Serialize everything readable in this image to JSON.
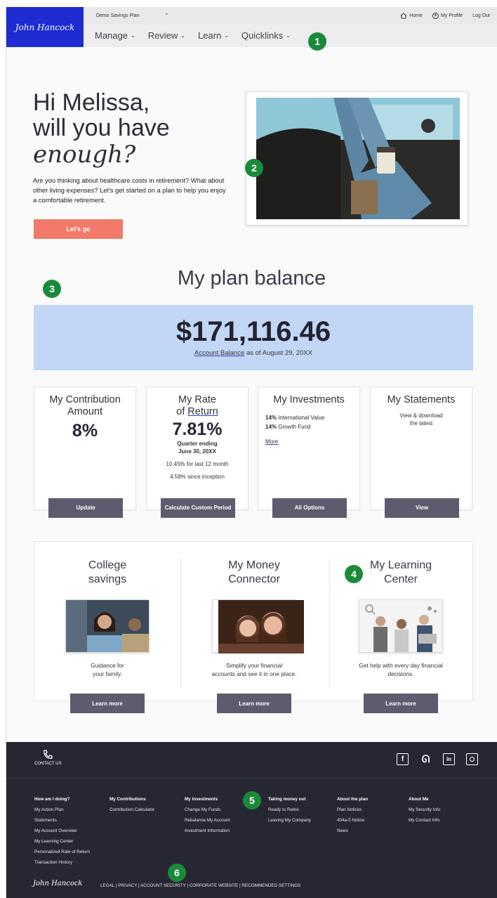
{
  "header": {
    "logo_text": "John Hancock",
    "plan_selector": "Demo Savings Plan",
    "top_links": {
      "home": "Home",
      "profile": "My Profile",
      "logout": "Log Out"
    },
    "nav": [
      "Manage",
      "Review",
      "Learn",
      "Quicklinks"
    ]
  },
  "badges": [
    "1",
    "2",
    "3",
    "4",
    "5",
    "6"
  ],
  "hero": {
    "line1": "Hi Melissa,",
    "line2": "will you have",
    "line3": "enough?",
    "description": "Are you thinking about healthcare costs in retirement? What about other living expenses? Let's get started on a plan to help you enjoy a comfortable retirement.",
    "cta": "Let's go"
  },
  "balance": {
    "title": "My plan balance",
    "amount": "$171,116.46",
    "label": "Account Balance",
    "as_of": "as of August 29, 20XX"
  },
  "cards": {
    "contribution": {
      "title1": "My Contribution",
      "title2": "Amount",
      "value": "8%",
      "button": "Update"
    },
    "return": {
      "title1": "My Rate",
      "title2a": "of ",
      "title2b": "Return",
      "value": "7.81%",
      "period1": "Quarter ending",
      "period2": "June 30, 20XX",
      "line1": "10.45% for last 12 month",
      "line2": "4.58% since inception",
      "button": "Calculate Custom Period"
    },
    "investments": {
      "title": "My Investments",
      "items": [
        {
          "pct": "14%",
          "name": "International Value"
        },
        {
          "pct": "14%",
          "name": "Growth Fund"
        }
      ],
      "more": "More",
      "button": "All Options"
    },
    "statements": {
      "title": "My Statements",
      "desc1": "View & download",
      "desc2": "the latest",
      "button": "View"
    }
  },
  "learn": [
    {
      "title1": "College",
      "title2": "savings",
      "desc1": "Guidance for",
      "desc2": "your family.",
      "button": "Learn more"
    },
    {
      "title1": "My Money",
      "title2": "Connector",
      "desc1": "Simplify your financial",
      "desc2": "accounts and see it in one place.",
      "button": "Learn more"
    },
    {
      "title1": "My Learning",
      "title2": "Center",
      "desc1": "Get help with every day financial",
      "desc2": "decisions.",
      "button": "Learn more"
    }
  ],
  "footer": {
    "contact": "CONTACT US",
    "social": [
      "f",
      "t",
      "in",
      "ig"
    ],
    "columns": [
      {
        "heading": "How am I doing?",
        "links": [
          "My Action Plan",
          "Statements",
          "My Account Overview",
          "My Learning Center",
          "Personalized Rate of Return",
          "Transaction History"
        ]
      },
      {
        "heading": "My Contributions",
        "links": [
          "Contribution Calculator"
        ]
      },
      {
        "heading": "My investments",
        "links": [
          "Change My Funds",
          "Rebalance My Account",
          "Investment Information"
        ]
      },
      {
        "heading": "Taking money out",
        "links": [
          "Ready to Retire",
          "Leaving My Company"
        ]
      },
      {
        "heading": "About the plan",
        "links": [
          "Plan Notices",
          "404a-5 Notice",
          "News"
        ]
      },
      {
        "heading": "About Me",
        "links": [
          "My Security Info",
          "My Contact Info"
        ]
      }
    ],
    "logo_text": "John Hancock",
    "legal_links": [
      "LEGAL",
      "PRIVACY",
      "ACCOUNT SECURITY",
      "CORPORATE WEBSITE",
      "RECOMMENDED SETTINGS"
    ]
  }
}
